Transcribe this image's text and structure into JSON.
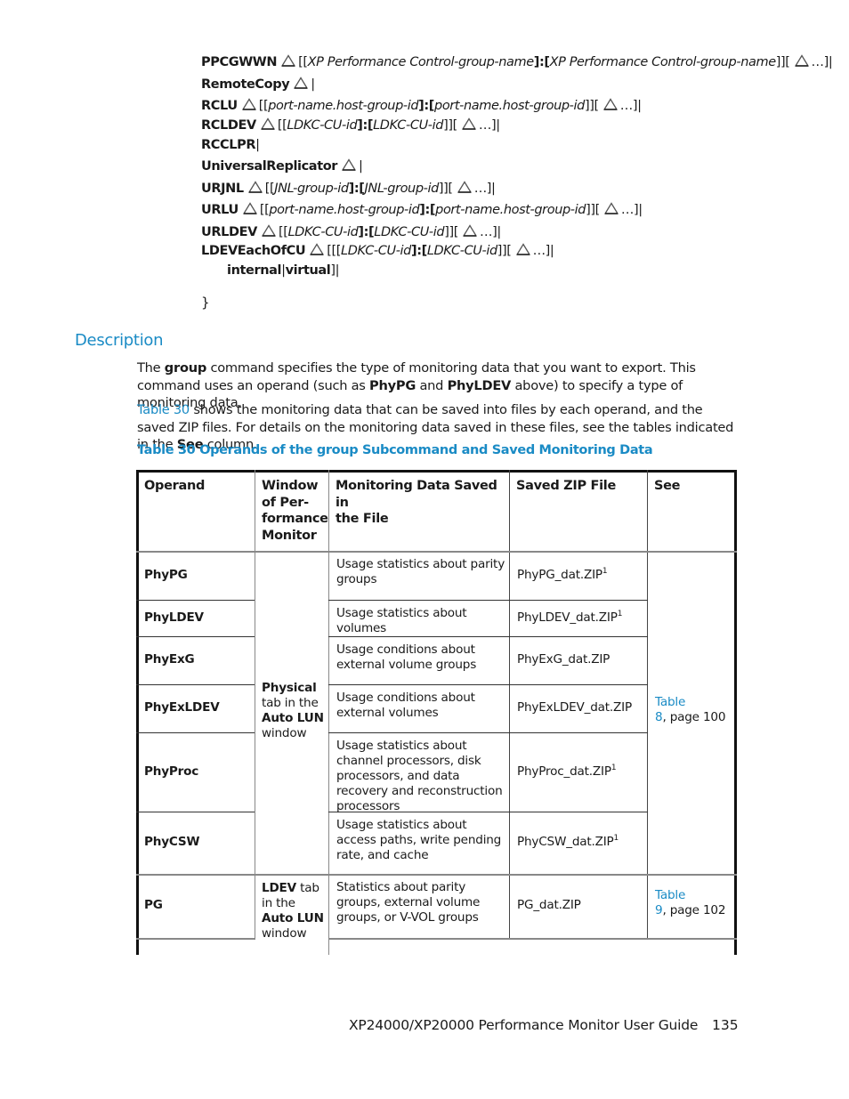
{
  "syntax": {
    "lines": [
      {
        "keyword": "PPCGWWN",
        "args": "[[",
        "arg1": "XP Performance Control-group-name",
        "sep": "]:[",
        "arg2": "XP Performance Control-group-name",
        "close": "]][",
        "tail": "…]|",
        "icon": "space-triangle-icon"
      },
      {
        "keyword": "RemoteCopy",
        "tail": "|",
        "icon": "space-triangle-icon"
      },
      {
        "keyword": "RCLU",
        "args": "[[",
        "arg1": "port-name.host-group-id",
        "sep": "]:[",
        "arg2": "port-name.host-group-id",
        "close": "]][",
        "tail": "…]|",
        "icon": "space-triangle-icon"
      },
      {
        "keyword": "RCLDEV",
        "args": "[[",
        "arg1": "LDKC-CU-id",
        "sep": "]:[",
        "arg2": "LDKC-CU-id",
        "close": "]][",
        "tail": "…]|",
        "icon": "space-triangle-icon"
      },
      {
        "keyword": "RCCLPR",
        "tail": "|"
      },
      {
        "keyword": "UniversalReplicator",
        "tail": "|",
        "icon": "space-triangle-icon"
      },
      {
        "keyword": "URJNL",
        "args": "[[",
        "arg1": "JNL-group-id",
        "sep": "]:[",
        "arg2": "JNL-group-id",
        "close": "]][",
        "tail": "…]|",
        "icon": "space-triangle-icon"
      },
      {
        "keyword": "URLU",
        "args": "[[",
        "arg1": "port-name.host-group-id",
        "sep": "]:[",
        "arg2": "port-name.host-group-id",
        "close": "]][",
        "tail": "…]|",
        "icon": "space-triangle-icon"
      },
      {
        "keyword": "URLDEV",
        "args": "[[",
        "arg1": "LDKC-CU-id",
        "sep": "]:[",
        "arg2": "LDKC-CU-id",
        "close": "]][",
        "tail": "…]|",
        "icon": "space-triangle-icon"
      },
      {
        "keyword": "LDEVEachOfCU",
        "args": "[[[",
        "arg1": "LDKC-CU-id",
        "sep": "]:[",
        "arg2": "LDKC-CU-id",
        "close": "]][",
        "tail": "…]|",
        "icon": "space-triangle-icon"
      }
    ],
    "continuation": {
      "kw1": "internal",
      "sep": "|",
      "kw2": "virtual",
      "tail": "]|"
    },
    "closing_brace": "}"
  },
  "description": {
    "heading": "Description",
    "p1": {
      "t1": "The ",
      "b1": "group",
      "t2": " command specifies the type of monitoring data that you want to export. This command uses an operand (such as ",
      "b2": "PhyPG",
      "t3": " and ",
      "b3": "PhyLDEV",
      "t4": " above) to specify a type of monitoring data."
    },
    "p2": {
      "link": "Table 30",
      "t1": " shows the monitoring data that can be saved into files by each operand, and the saved ZIP files. For details on the monitoring data saved in these files, see the tables indicated in the ",
      "b1": "See",
      "t2": " column."
    }
  },
  "table": {
    "caption": "Table 30 Operands of the group Subcommand and Saved Monitoring Data",
    "headers": [
      "Operand",
      "Window of Per-formance Monitor",
      "Monitoring Data Saved in the File",
      "Saved ZIP File",
      "See"
    ],
    "header_lines": {
      "window": [
        "Window",
        "of Per-",
        "formance",
        "Monitor"
      ],
      "monitoring": [
        "Monitoring Data Saved in",
        "the File"
      ]
    },
    "rows": [
      {
        "operand": "PhyPG",
        "data": "Usage statistics about parity groups",
        "zip": "PhyPG_dat.ZIP",
        "note": "1"
      },
      {
        "operand": "PhyLDEV",
        "data": "Usage statistics about volumes",
        "zip": "PhyLDEV_dat.ZIP",
        "note": "1"
      },
      {
        "operand": "PhyExG",
        "data": "Usage conditions about external volume groups",
        "zip": "PhyExG_dat.ZIP",
        "note": ""
      },
      {
        "operand": "PhyExLDEV",
        "data": "Usage conditions about external volumes",
        "zip": "PhyExLDEV_dat.ZIP",
        "note": ""
      },
      {
        "operand": "PhyProc",
        "data": "Usage statistics about channel processors, disk processors, and data recovery and reconstruction processors",
        "zip": "PhyProc_dat.ZIP",
        "note": "1"
      },
      {
        "operand": "PhyCSW",
        "data": "Usage statistics about access paths, write pending rate, and cache",
        "zip": "PhyCSW_dat.ZIP",
        "note": "1"
      },
      {
        "operand": "PG",
        "data": "Statistics about parity groups, external volume groups, or V-VOL groups",
        "zip": "PG_dat.ZIP",
        "note": ""
      }
    ],
    "window_physical": {
      "b1": "Physical",
      "t1": "tab in the",
      "b2": "Auto LUN",
      "t2": "window"
    },
    "window_ldev": {
      "b1": "LDEV",
      "t1": " tab in the ",
      "b2": "Auto LUN",
      "t2": "window"
    },
    "see_physical": {
      "link1": "Table",
      "link2": "8",
      "text": ", page 100"
    },
    "see_ldev": {
      "link1": "Table",
      "link2": "9",
      "text": ", page 102"
    }
  },
  "footer": {
    "title": "XP24000/XP20000 Performance Monitor User Guide",
    "page": "135"
  },
  "colors": {
    "accent": "#1a8bc5",
    "text": "#1a1a1a"
  }
}
